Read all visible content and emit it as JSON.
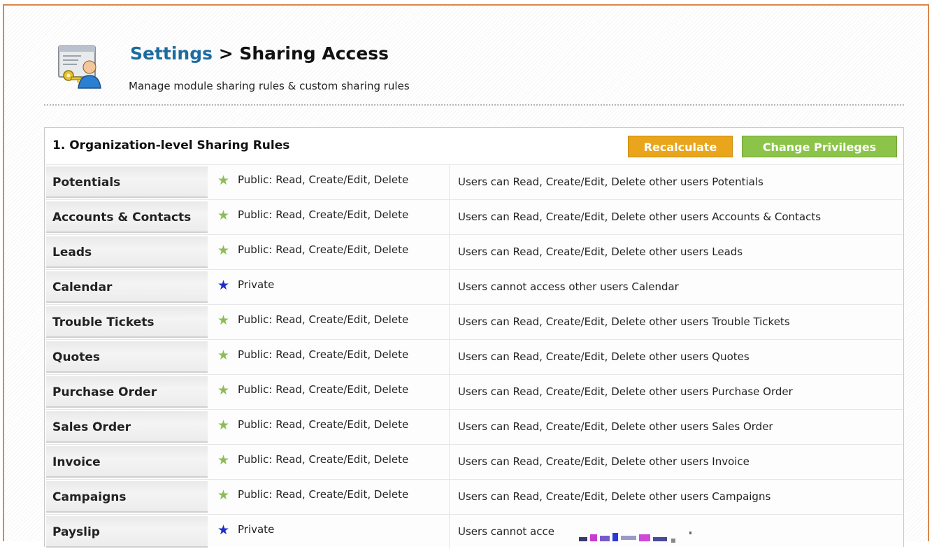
{
  "header": {
    "breadcrumb_root": "Settings",
    "breadcrumb_sep": " > ",
    "page_title": "Sharing Access",
    "subtitle": "Manage module sharing rules & custom sharing rules"
  },
  "section": {
    "title": "1. Organization-level Sharing Rules",
    "recalculate_label": "Recalculate",
    "change_privileges_label": "Change Privileges"
  },
  "colors": {
    "public_star": "#8bbd55",
    "private_star": "#1a2fc8",
    "recalculate_button": "#e9a51c",
    "change_privileges_button": "#8cc44a",
    "breadcrumb_link": "#1c6ba0"
  },
  "rules": [
    {
      "module": "Potentials",
      "access_type": "public",
      "access": "Public: Read, Create/Edit, Delete",
      "description": "Users can Read, Create/Edit, Delete other users Potentials"
    },
    {
      "module": "Accounts & Contacts",
      "access_type": "public",
      "access": "Public: Read, Create/Edit, Delete",
      "description": "Users can Read, Create/Edit, Delete other users Accounts & Contacts"
    },
    {
      "module": "Leads",
      "access_type": "public",
      "access": "Public: Read, Create/Edit, Delete",
      "description": "Users can Read, Create/Edit, Delete other users Leads"
    },
    {
      "module": "Calendar",
      "access_type": "private",
      "access": "Private",
      "description": "Users cannot access other users Calendar"
    },
    {
      "module": "Trouble Tickets",
      "access_type": "public",
      "access": "Public: Read, Create/Edit, Delete",
      "description": "Users can Read, Create/Edit, Delete other users Trouble Tickets"
    },
    {
      "module": "Quotes",
      "access_type": "public",
      "access": "Public: Read, Create/Edit, Delete",
      "description": "Users can Read, Create/Edit, Delete other users Quotes"
    },
    {
      "module": "Purchase Order",
      "access_type": "public",
      "access": "Public: Read, Create/Edit, Delete",
      "description": "Users can Read, Create/Edit, Delete other users Purchase Order"
    },
    {
      "module": "Sales Order",
      "access_type": "public",
      "access": "Public: Read, Create/Edit, Delete",
      "description": "Users can Read, Create/Edit, Delete other users Sales Order"
    },
    {
      "module": "Invoice",
      "access_type": "public",
      "access": "Public: Read, Create/Edit, Delete",
      "description": "Users can Read, Create/Edit, Delete other users Invoice"
    },
    {
      "module": "Campaigns",
      "access_type": "public",
      "access": "Public: Read, Create/Edit, Delete",
      "description": "Users can Read, Create/Edit, Delete other users Campaigns"
    },
    {
      "module": "Payslip",
      "access_type": "private",
      "access": "Private",
      "description": "Users cannot acce"
    }
  ]
}
